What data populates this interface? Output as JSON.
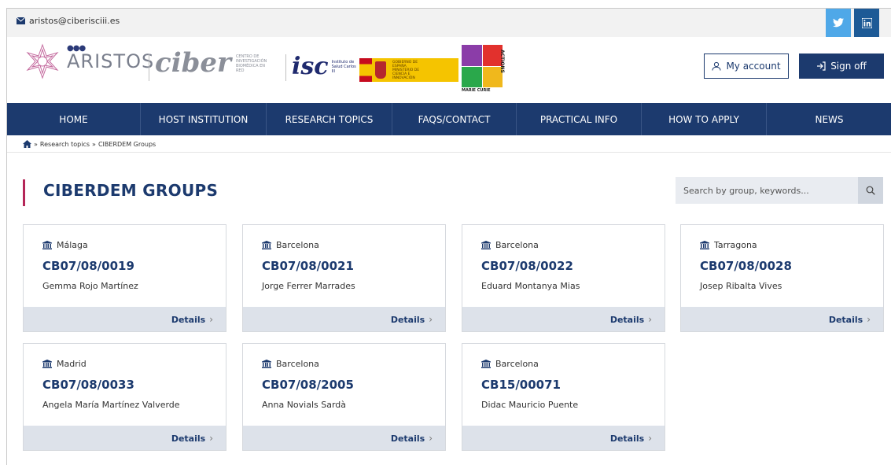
{
  "topbar": {
    "email": "aristos@ciberisciii.es"
  },
  "header": {
    "aristos": "ARISTOS",
    "ciber": "ciber",
    "ciber_sub": "CENTRO DE INVESTIGACIÓN BIOMÉDICA EN RED",
    "isc": "isc",
    "isc_sub": "Instituto de Salud Carlos III",
    "gob_sub": "GOBIERNO DE ESPAÑA  MINISTERIO DE CIENCIA E INNOVACIÓN",
    "mc_label": "MARIE CURIE",
    "mc_vertical": "ACTIONS",
    "my_account": "My account",
    "sign_off": "Sign off"
  },
  "nav": [
    {
      "label": "HOME"
    },
    {
      "label": "HOST INSTITUTION"
    },
    {
      "label": "RESEARCH TOPICS"
    },
    {
      "label": "FAQS/CONTACT"
    },
    {
      "label": "PRACTICAL INFO"
    },
    {
      "label": "HOW TO APPLY"
    },
    {
      "label": "NEWS"
    }
  ],
  "breadcrumb": {
    "sep1": "»",
    "topics": "Research topics",
    "sep2": "»",
    "current": "CIBERDEM Groups"
  },
  "page": {
    "title": "CIBERDEM GROUPS",
    "search_placeholder": "Search by group, keywords..."
  },
  "details_label": "Details",
  "cards": [
    {
      "city": "Málaga",
      "code": "CB07/08/0019",
      "name": "Gemma Rojo Martínez"
    },
    {
      "city": "Barcelona",
      "code": "CB07/08/0021",
      "name": "Jorge Ferrer Marrades"
    },
    {
      "city": "Barcelona",
      "code": "CB07/08/0022",
      "name": "Eduard Montanya Mias"
    },
    {
      "city": "Tarragona",
      "code": "CB07/08/0028",
      "name": "Josep Ribalta Vives"
    },
    {
      "city": "Madrid",
      "code": "CB07/08/0033",
      "name": "Angela María Martínez Valverde"
    },
    {
      "city": "Barcelona",
      "code": "CB07/08/2005",
      "name": "Anna Novials Sardà"
    },
    {
      "city": "Barcelona",
      "code": "CB15/00071",
      "name": "Didac Mauricio Puente"
    }
  ],
  "colors": {
    "primary": "#1c3a6e",
    "accent": "#b52658",
    "card_footer": "#dde2ea",
    "twitter": "#4fa8e8",
    "linkedin": "#1d5a96"
  }
}
